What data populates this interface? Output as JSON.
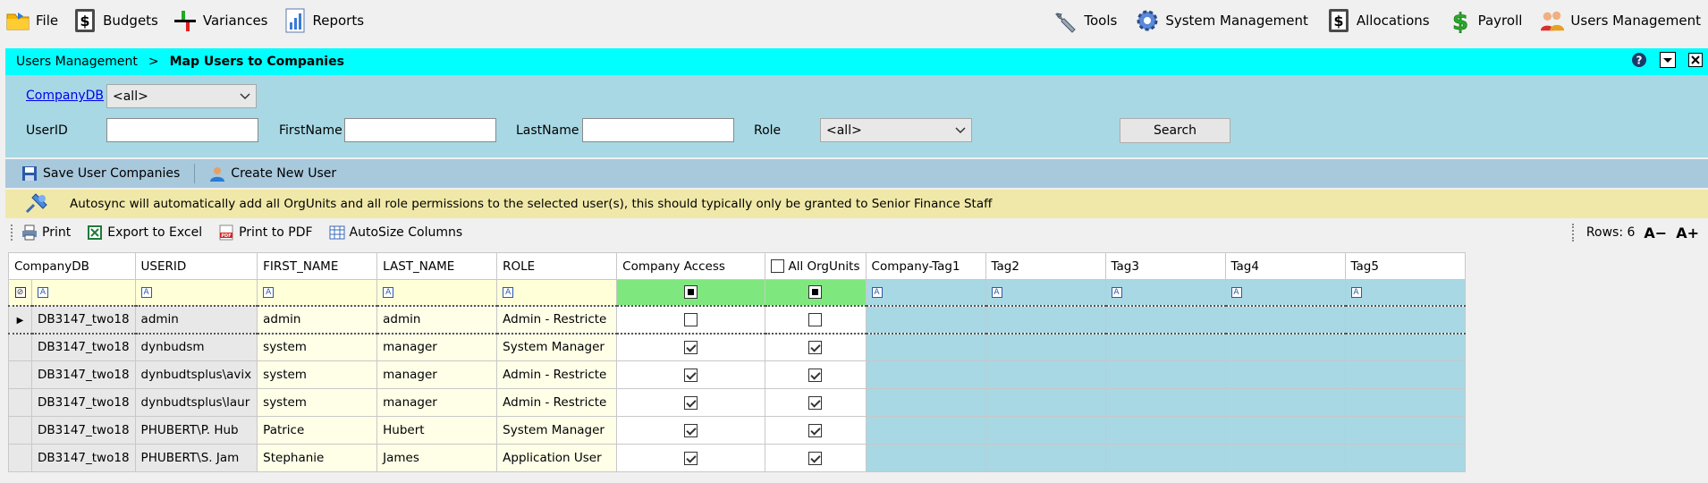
{
  "toolbar": {
    "file": "File",
    "budgets": "Budgets",
    "variances": "Variances",
    "reports": "Reports",
    "tools": "Tools",
    "system_management": "System Management",
    "allocations": "Allocations",
    "payroll": "Payroll",
    "users_management": "Users Management"
  },
  "breadcrumb": {
    "parent": "Users Management",
    "separator": ">",
    "current": "Map Users to Companies"
  },
  "filters": {
    "companydb_label": "CompanyDB",
    "companydb_value": "<all>",
    "userid_label": "UserID",
    "userid_value": "",
    "firstname_label": "FirstName",
    "firstname_value": "",
    "lastname_label": "LastName",
    "lastname_value": "",
    "role_label": "Role",
    "role_value": "<all>",
    "search_label": "Search"
  },
  "actions": {
    "save": "Save User Companies",
    "create": "Create New User"
  },
  "notice": "Autosync will automatically add all OrgUnits and all role permissions to the selected user(s), this should typically only be granted to Senior Finance Staff",
  "gridbar": {
    "print": "Print",
    "export_excel": "Export to Excel",
    "print_pdf": "Print to PDF",
    "autosize": "AutoSize Columns",
    "rows_label": "Rows: 6",
    "decrease_font": "A−",
    "increase_font": "A+"
  },
  "columns": [
    "CompanyDB",
    "USERID",
    "FIRST_NAME",
    "LAST_NAME",
    "ROLE",
    "Company Access",
    "All OrgUnits",
    "Company-Tag1",
    "Tag2",
    "Tag3",
    "Tag4",
    "Tag5"
  ],
  "rows": [
    {
      "companydb": "DB3147_two18",
      "userid": "admin",
      "first": "admin",
      "last": "admin",
      "role": "Admin - Restricte",
      "access": false,
      "orgunits": false
    },
    {
      "companydb": "DB3147_two18",
      "userid": "dynbudsm",
      "first": "system",
      "last": "manager",
      "role": "System Manager",
      "access": true,
      "orgunits": true
    },
    {
      "companydb": "DB3147_two18",
      "userid": "dynbudtsplus\\avix",
      "first": "system",
      "last": "manager",
      "role": "Admin - Restricte",
      "access": true,
      "orgunits": true
    },
    {
      "companydb": "DB3147_two18",
      "userid": "dynbudtsplus\\laur",
      "first": "system",
      "last": "manager",
      "role": "Admin - Restricte",
      "access": true,
      "orgunits": true
    },
    {
      "companydb": "DB3147_two18",
      "userid": "PHUBERT\\P. Hub",
      "first": "Patrice",
      "last": "Hubert",
      "role": "System Manager",
      "access": true,
      "orgunits": true
    },
    {
      "companydb": "DB3147_two18",
      "userid": "PHUBERT\\S. Jam",
      "first": "Stephanie",
      "last": "James",
      "role": "Application User",
      "access": true,
      "orgunits": true
    }
  ]
}
